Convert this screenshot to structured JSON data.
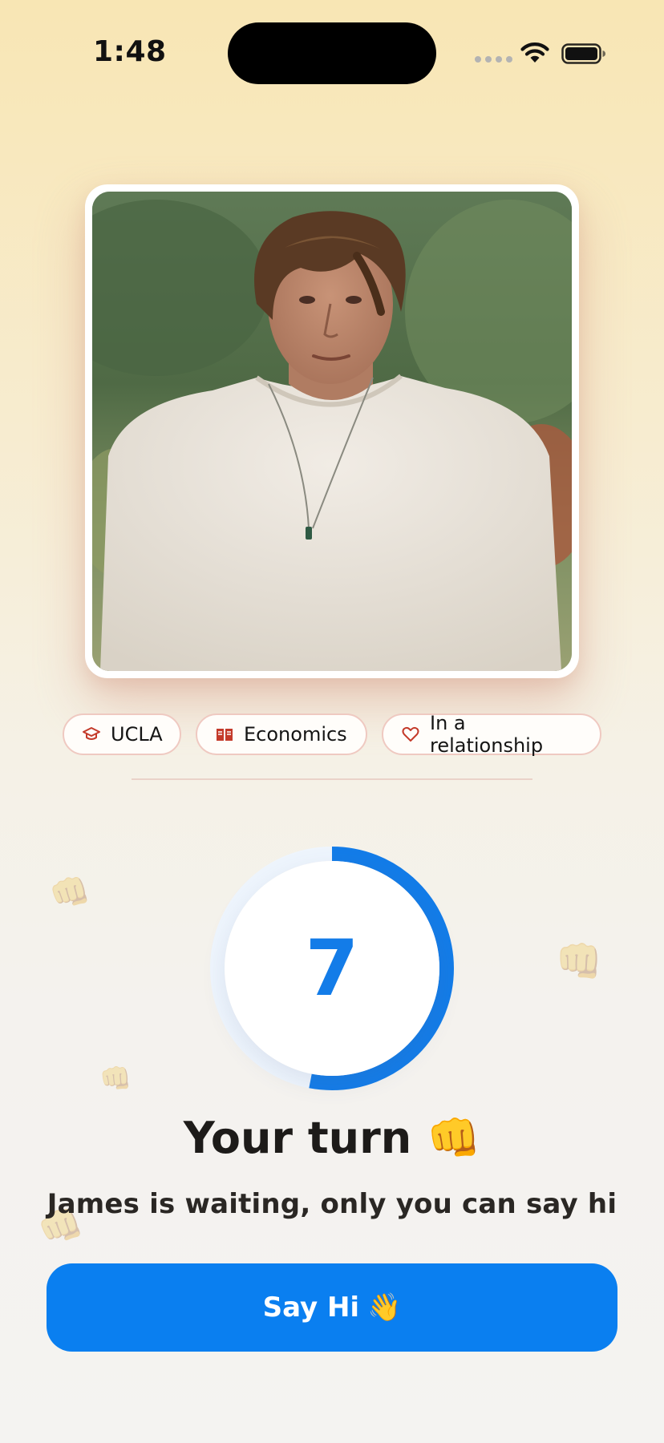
{
  "status_bar": {
    "time": "1:48",
    "icons": [
      "signal-dots-icon",
      "wifi-icon",
      "battery-icon"
    ]
  },
  "profile": {
    "photo_alt": "Profile photo",
    "tags": [
      {
        "icon": "graduation-cap-icon",
        "label": "UCLA"
      },
      {
        "icon": "book-icon",
        "label": "Economics"
      },
      {
        "icon": "heart-icon",
        "label": "In a relationship"
      }
    ]
  },
  "countdown": {
    "value": "7",
    "progress_fraction": 0.53,
    "accent_color": "#137CE8",
    "track_color": "#EEF5FD"
  },
  "turn": {
    "title": "Your turn",
    "title_emoji": "👊",
    "subtitle": "James is waiting, only you can say hi"
  },
  "cta": {
    "label": "Say Hi",
    "emoji": "👋",
    "color": "#0A7FF0"
  },
  "decorations": {
    "fist_emoji": "👊"
  }
}
